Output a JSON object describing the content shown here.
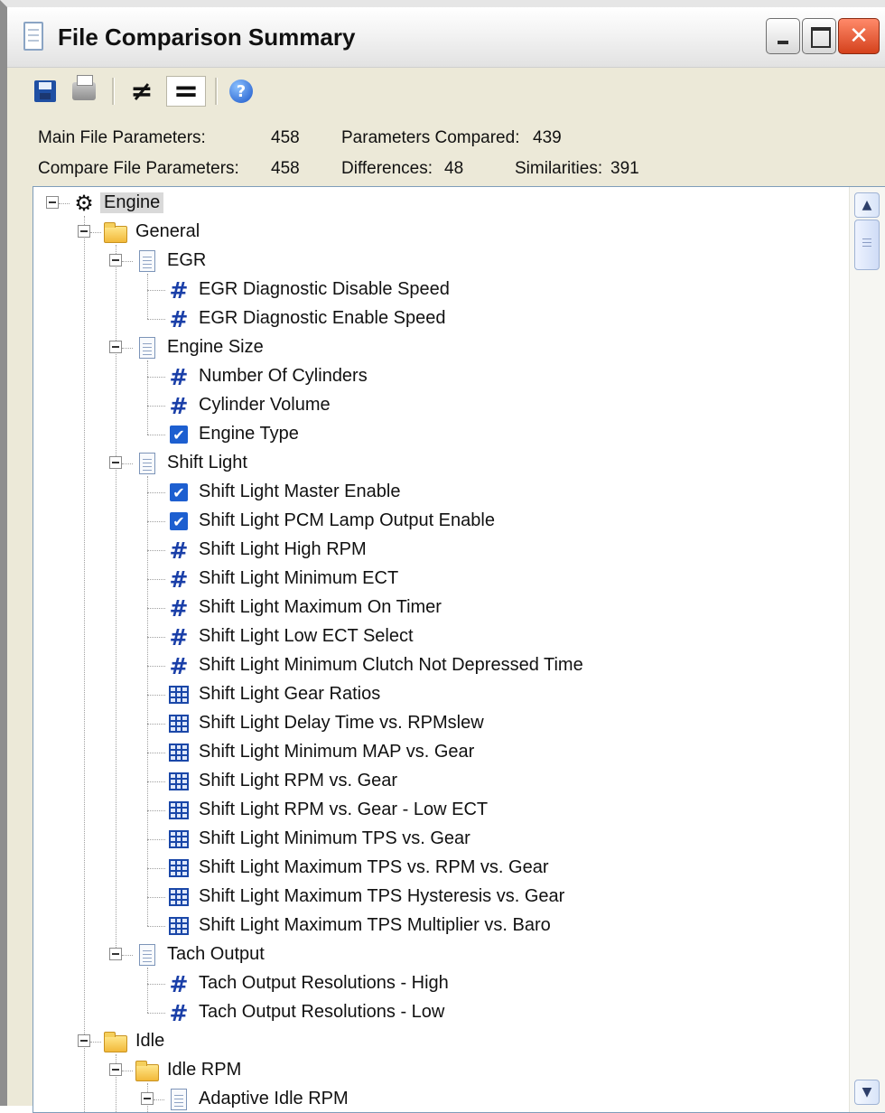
{
  "window": {
    "title": "File Comparison Summary",
    "minimize_glyph": "",
    "maximize_glyph": "",
    "close_glyph": "✕"
  },
  "toolbar": {
    "save_icon": "save-icon",
    "print_icon": "print-icon",
    "show_differences_glyph": "≠",
    "show_similarities_glyph": "=",
    "help_glyph": "?"
  },
  "stats": {
    "main_file_label": "Main File Parameters:",
    "main_file_value": "458",
    "compare_file_label": "Compare File Parameters:",
    "compare_file_value": "458",
    "compared_label": "Parameters Compared:",
    "compared_value": "439",
    "differences_label": "Differences:",
    "differences_value": "48",
    "similarities_label": "Similarities:",
    "similarities_value": "391"
  },
  "tree": {
    "items": [
      {
        "label": "Engine",
        "icon": "engine-icon",
        "level": 0,
        "expanded": true,
        "selected": true
      },
      {
        "label": "General",
        "icon": "folder-icon",
        "level": 1,
        "expanded": true
      },
      {
        "label": "EGR",
        "icon": "document-icon",
        "level": 2,
        "expanded": true
      },
      {
        "label": "EGR Diagnostic Disable Speed",
        "icon": "hash-icon",
        "level": 3
      },
      {
        "label": "EGR Diagnostic Enable Speed",
        "icon": "hash-icon",
        "level": 3
      },
      {
        "label": "Engine Size",
        "icon": "document-icon",
        "level": 2,
        "expanded": true
      },
      {
        "label": "Number Of Cylinders",
        "icon": "hash-icon",
        "level": 3
      },
      {
        "label": "Cylinder Volume",
        "icon": "hash-icon",
        "level": 3
      },
      {
        "label": "Engine Type",
        "icon": "checkbox-icon",
        "level": 3
      },
      {
        "label": "Shift Light",
        "icon": "document-icon",
        "level": 2,
        "expanded": true
      },
      {
        "label": "Shift Light Master Enable",
        "icon": "checkbox-icon",
        "level": 3
      },
      {
        "label": "Shift Light PCM Lamp Output Enable",
        "icon": "checkbox-icon",
        "level": 3
      },
      {
        "label": "Shift Light High RPM",
        "icon": "hash-icon",
        "level": 3
      },
      {
        "label": "Shift Light Minimum ECT",
        "icon": "hash-icon",
        "level": 3
      },
      {
        "label": "Shift Light Maximum On Timer",
        "icon": "hash-icon",
        "level": 3
      },
      {
        "label": "Shift Light Low ECT Select",
        "icon": "hash-icon",
        "level": 3
      },
      {
        "label": "Shift Light Minimum Clutch Not Depressed Time",
        "icon": "hash-icon",
        "level": 3
      },
      {
        "label": "Shift Light Gear Ratios",
        "icon": "table-icon",
        "level": 3
      },
      {
        "label": "Shift Light Delay Time vs. RPMslew",
        "icon": "table-icon",
        "level": 3
      },
      {
        "label": "Shift Light Minimum MAP vs. Gear",
        "icon": "table-icon",
        "level": 3
      },
      {
        "label": "Shift Light RPM vs. Gear",
        "icon": "table-icon",
        "level": 3
      },
      {
        "label": "Shift Light RPM vs. Gear - Low ECT",
        "icon": "table-icon",
        "level": 3
      },
      {
        "label": "Shift Light Minimum TPS vs. Gear",
        "icon": "table-icon",
        "level": 3
      },
      {
        "label": "Shift Light Maximum TPS vs. RPM vs. Gear",
        "icon": "table-icon",
        "level": 3
      },
      {
        "label": "Shift Light Maximum TPS Hysteresis vs. Gear",
        "icon": "table-icon",
        "level": 3
      },
      {
        "label": "Shift Light Maximum TPS Multiplier vs. Baro",
        "icon": "table-icon",
        "level": 3
      },
      {
        "label": "Tach Output",
        "icon": "document-icon",
        "level": 2,
        "expanded": true
      },
      {
        "label": "Tach Output Resolutions - High",
        "icon": "hash-icon",
        "level": 3
      },
      {
        "label": "Tach Output Resolutions - Low",
        "icon": "hash-icon",
        "level": 3
      },
      {
        "label": "Idle",
        "icon": "folder-icon",
        "level": 1,
        "expanded": true
      },
      {
        "label": "Idle RPM",
        "icon": "folder-icon",
        "level": 2,
        "expanded": true
      },
      {
        "label": "Adaptive Idle RPM",
        "icon": "document-icon",
        "level": 3,
        "expanded": true
      }
    ]
  },
  "scrollbar": {
    "up_glyph": "▲",
    "down_glyph": "▼",
    "position": 0.02
  }
}
